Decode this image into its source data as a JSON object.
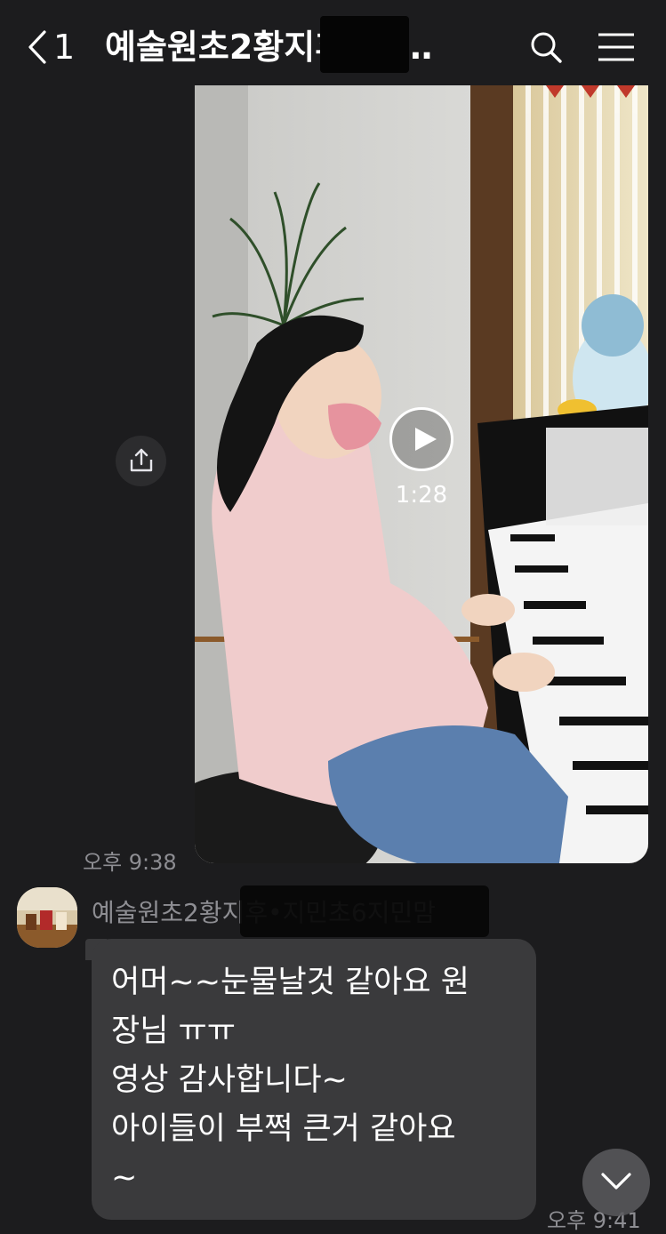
{
  "header": {
    "back_count": "1",
    "title": "예술원초2황지후•지…"
  },
  "video": {
    "duration": "1:28"
  },
  "messages": [
    {
      "time": "오후 9:38"
    },
    {
      "sender": "예술원초2황지후•지민초6지민맘",
      "lines": [
        "어머~~눈물날것 같아요 원",
        "장님 ㅠㅠ",
        "영상 감사합니다~",
        "아이들이 부쩍 큰거 같아요",
        "~"
      ],
      "time": "오후 9:41"
    }
  ],
  "icons": {
    "back": "chevron-left-icon",
    "search": "search-icon",
    "menu": "menu-icon",
    "share": "share-icon",
    "play": "play-icon",
    "scroll_down": "chevron-down-icon"
  },
  "colors": {
    "background": "#1c1c1e",
    "bubble": "#3a3a3c",
    "meta_text": "#8e8e93"
  }
}
